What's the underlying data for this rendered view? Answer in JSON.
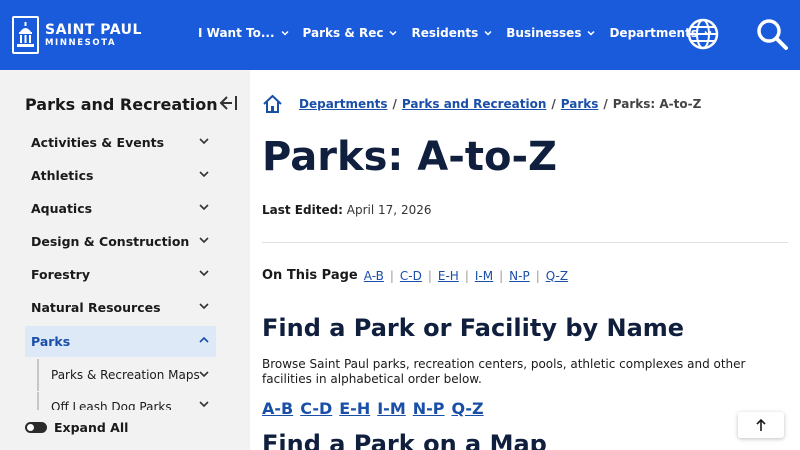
{
  "header": {
    "logo": {
      "line1": "SAINT PAUL",
      "line2": "MINNESOTA"
    },
    "nav": [
      "I Want To...",
      "Parks & Rec",
      "Residents",
      "Businesses",
      "Departments"
    ],
    "icons": [
      "globe-icon",
      "search-icon"
    ],
    "colors": {
      "brand": "#1a5bdb"
    }
  },
  "sidebar": {
    "title": "Parks and Recreation",
    "items": [
      "Activities & Events",
      "Athletics",
      "Aquatics",
      "Design & Construction",
      "Forestry",
      "Natural Resources",
      "Parks"
    ],
    "active_item": "Parks",
    "sub_items": [
      "Parks & Recreation Maps",
      "Off Leash Dog Parks"
    ],
    "expand_all": "Expand All"
  },
  "breadcrumb": {
    "links": [
      "Departments",
      "Parks and Recreation",
      "Parks"
    ],
    "separator": "/",
    "current": "Parks: A-to-Z"
  },
  "main": {
    "title": "Parks: A-to-Z",
    "last_edited_label": "Last Edited:",
    "last_edited_value": "April 17, 2026",
    "on_this_page_label": "On This Page",
    "on_this_page_links": [
      "A-B",
      "C-D",
      "E-H",
      "I-M",
      "N-P",
      "Q-Z"
    ],
    "section1_title": "Find a Park or Facility by Name",
    "section1_text": "Browse Saint Paul parks, recreation centers, pools, athletic complexes and other facilities in alphabetical order below.",
    "az_links": [
      "A-B",
      "C-D",
      "E-H",
      "I-M",
      "N-P",
      "Q-Z"
    ],
    "section2_title": "Find a Park on a Map"
  }
}
